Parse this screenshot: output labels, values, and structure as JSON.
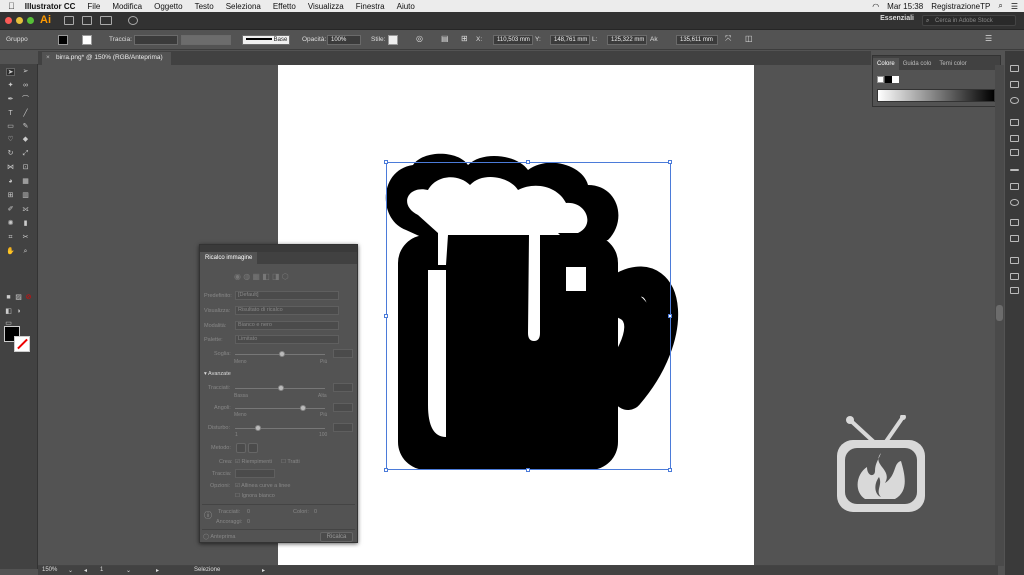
{
  "menubar": {
    "app_name": "Illustrator CC",
    "items": [
      "File",
      "Modifica",
      "Oggetto",
      "Testo",
      "Seleziona",
      "Effetto",
      "Visualizza",
      "Finestra",
      "Aiuto"
    ],
    "clock": "Mar 15:38",
    "user": "RegistrazioneTP"
  },
  "appbar": {
    "logo": "Ai",
    "workspace": "Essenziali",
    "search_placeholder": "Cerca in Adobe Stock"
  },
  "controlbar": {
    "selection_type": "Gruppo",
    "stroke_label": "Traccia:",
    "stroke_profile": "Base",
    "opacity_label": "Opacità:",
    "opacity_value": "100%",
    "style_label": "Stile:",
    "x_label": "X:",
    "x_value": "110,503 mm",
    "y_label": "Y:",
    "y_value": "148,761 mm",
    "l_label": "L:",
    "l_value": "125,322 mm",
    "h_label": "Ak",
    "h_value": "135,611 mm"
  },
  "document_tab": {
    "title": "birra.png* @ 150% (RGB/Anteprima)"
  },
  "color_panel": {
    "tabs": [
      "Colore",
      "Guida colo",
      "Temi color"
    ]
  },
  "trace_panel": {
    "title": "Ricalco immagine",
    "predefinito_label": "Predefinito:",
    "predefinito_value": "[Default]",
    "visualizza_label": "Visualizza:",
    "visualizza_value": "Risultato di ricalco",
    "modalita_label": "Modalità:",
    "modalita_value": "Bianco e nero",
    "palette_label": "Palette:",
    "palette_value": "Limitato",
    "soglia_label": "Soglia:",
    "soglia_min": "Meno",
    "soglia_max": "Più",
    "avanzate_label": "Avanzate",
    "tracciati_label": "Tracciati:",
    "tracciati_min": "Bassa",
    "tracciati_max": "Alta",
    "angoli_label": "Angoli:",
    "angoli_min": "Meno",
    "angoli_max": "Più",
    "disturbo_label": "Disturbo:",
    "disturbo_min": "1",
    "disturbo_max": "100",
    "metodo_label": "Metodo:",
    "crea_label": "Crea:",
    "riempimenti": "Riempimenti",
    "tratti": "Tratti",
    "traccia_label": "Traccia:",
    "opzioni_label": "Opzioni:",
    "opzione_1": "Allinea curve a linee",
    "opzione_2": "Ignora bianco",
    "info_tracciati": "Tracciati:",
    "info_tracciati_val": "0",
    "info_colori": "Colori:",
    "info_colori_val": "0",
    "info_ancoraggi": "Ancoraggi:",
    "info_ancoraggi_val": "0",
    "anteprima": "Anteprima",
    "ricalca_button": "Ricalca"
  },
  "statusbar": {
    "zoom": "150%",
    "artboard_index": "1",
    "tool": "Selezione"
  },
  "colors": {
    "selection_blue": "#4b7bd9",
    "ai_orange": "#ff9a00",
    "ui_dark": "#535353",
    "logo_gray": "#d9d9d9"
  }
}
